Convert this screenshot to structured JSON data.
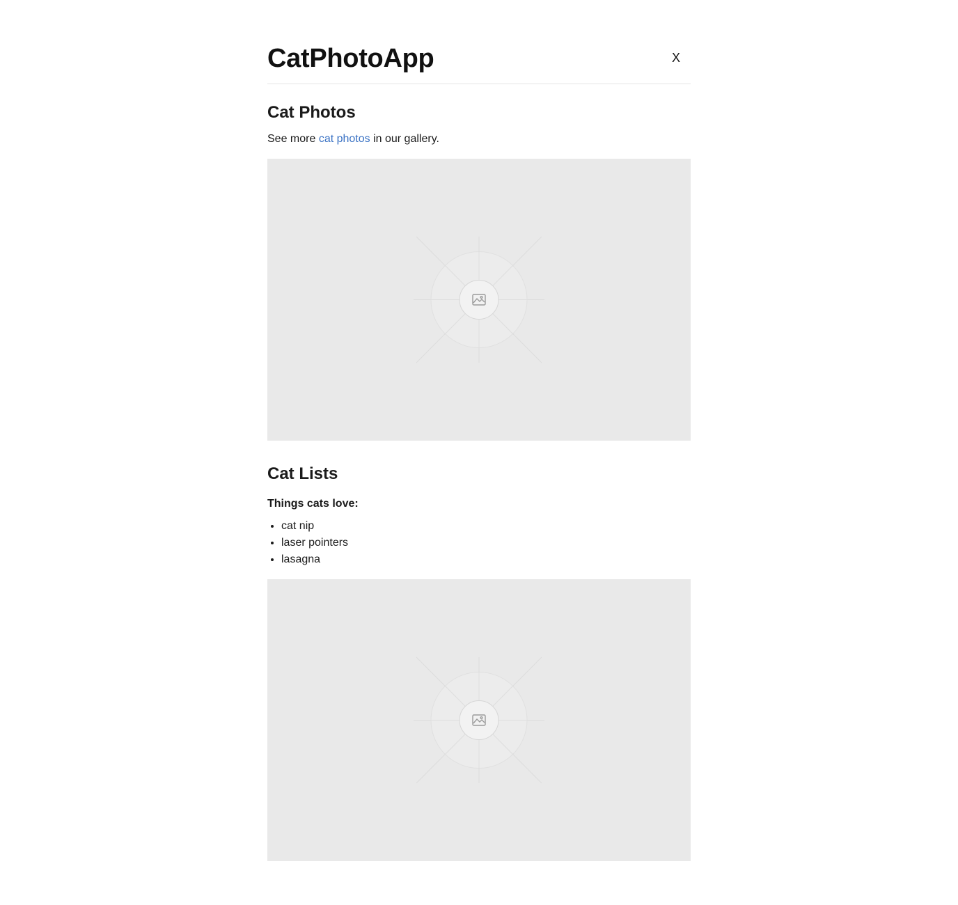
{
  "header": {
    "title": "CatPhotoApp",
    "close_label": "X"
  },
  "photos_section": {
    "title": "Cat Photos",
    "intro_before": "See more ",
    "link_text": "cat photos",
    "intro_after": " in our gallery.",
    "image_icon": "image-placeholder-icon"
  },
  "lists_section": {
    "title": "Cat Lists",
    "caption": "Things cats love:",
    "items": [
      "cat nip",
      "laser pointers",
      "lasagna"
    ],
    "image_icon": "image-placeholder-icon"
  },
  "colors": {
    "link": "#3a72c4",
    "placeholder_bg": "#e9e9e9",
    "divider": "#e3e3e3"
  }
}
